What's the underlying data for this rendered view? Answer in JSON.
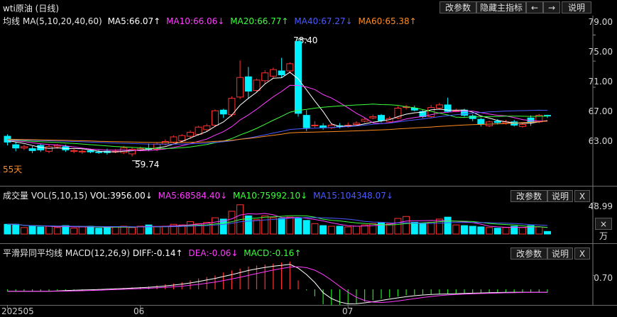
{
  "main": {
    "title": "wti原油 (日线)",
    "buttons": {
      "params": "改参数",
      "hide": "隐藏主指标",
      "prev": "←",
      "next": "→",
      "help": "说明"
    },
    "indicator": {
      "name": "均线",
      "params": "MA(5,10,20,40,60)",
      "ma5": "MA5:66.07↑",
      "ma10": "MA10:66.06↓",
      "ma20": "MA20:66.77↑",
      "ma40": "MA40:67.27↓",
      "ma60": "MA60:65.38↑"
    },
    "y_ticks": [
      "79.00",
      "75.00",
      "71.00",
      "67.00",
      "63.00"
    ],
    "high_label": "78.40",
    "low_label": "59.74",
    "days_label": "55天",
    "colors": {
      "ma5": "#ffffff",
      "ma10": "#ff3cff",
      "ma20": "#3cff3c",
      "ma40": "#4a5aff",
      "ma60": "#ff8c20",
      "up": "#ff3030",
      "down": "#00f0ff"
    }
  },
  "volume": {
    "name": "成交量",
    "params": "VOL(5,10,15)",
    "vol": "VOL:3956.00↓",
    "ma5": "MA5:68584.40↓",
    "ma10": "MA10:75992.10↓",
    "ma15": "MA15:104348.07↓",
    "buttons": {
      "params": "改参数",
      "help": "说明",
      "close": "X"
    },
    "y_tick": "48.99",
    "unit": "×万"
  },
  "macd": {
    "name": "平滑异同平均线",
    "params": "MACD(12,26,9)",
    "diff": "DIFF:-0.14↑",
    "dea": "DEA:-0.06↓",
    "macd": "MACD:-0.16↑",
    "buttons": {
      "params": "改参数",
      "help": "说明",
      "close": "X"
    },
    "y_tick": "0.70"
  },
  "x_axis": [
    "202505",
    "06",
    "07"
  ],
  "chart_data": {
    "type": "candlestick",
    "open": [
      63.5,
      62.2,
      61.7,
      61.6,
      62.1,
      61.2,
      61.9,
      61.9,
      61.3,
      61.2,
      61.3,
      61.1,
      61.2,
      61.1,
      61.0,
      60.8,
      61.4,
      61.6,
      61.5,
      62.3,
      62.6,
      62.8,
      63.5,
      63.8,
      64.5,
      65.2,
      67.5,
      66.8,
      69.5,
      72.6,
      70.5,
      72.0,
      72.7,
      73.5,
      73.5,
      78.0,
      66.7,
      65.1,
      65.1,
      64.8,
      65.1,
      65.0,
      65.3,
      65.8,
      66.3,
      66.7,
      65.7,
      66.3,
      67.9,
      67.8,
      67.3,
      66.5,
      67.8,
      68.3,
      67.3,
      67.5,
      66.6,
      66.1,
      65.1,
      65.8,
      65.5,
      65.7,
      65.0,
      66.3,
      65.7,
      66.7
    ],
    "close": [
      62.6,
      61.7,
      61.9,
      61.3,
      61.4,
      61.9,
      62.1,
      61.4,
      61.3,
      61.2,
      61.1,
      61.0,
      61.0,
      61.2,
      61.7,
      61.5,
      61.6,
      61.5,
      62.3,
      62.7,
      63.4,
      63.6,
      64.1,
      64.9,
      65.1,
      67.4,
      66.9,
      69.3,
      72.5,
      70.4,
      72.1,
      73.2,
      73.7,
      72.9,
      74.6,
      67.0,
      64.8,
      65.2,
      64.8,
      65.2,
      65.0,
      65.2,
      65.5,
      66.1,
      66.5,
      65.9,
      66.2,
      67.8,
      68.0,
      67.5,
      66.5,
      67.9,
      68.3,
      67.3,
      67.4,
      66.7,
      66.2,
      65.4,
      65.7,
      65.6,
      65.7,
      65.2,
      65.3,
      65.7,
      66.7,
      66.6
    ],
    "high": [
      63.8,
      62.6,
      62.2,
      62.0,
      62.3,
      62.2,
      62.3,
      62.2,
      61.6,
      61.5,
      61.6,
      61.4,
      61.6,
      61.5,
      62.0,
      61.8,
      61.9,
      62.4,
      62.5,
      63.0,
      63.6,
      63.8,
      64.4,
      65.1,
      65.4,
      67.6,
      67.7,
      69.6,
      75.1,
      74.1,
      72.3,
      73.6,
      74.0,
      75.5,
      74.8,
      78.4,
      67.5,
      65.8,
      65.5,
      65.4,
      65.5,
      65.6,
      65.8,
      66.4,
      66.8,
      66.9,
      66.5,
      68.1,
      68.3,
      68.2,
      67.5,
      68.3,
      68.6,
      69.4,
      67.7,
      67.7,
      66.9,
      66.3,
      65.9,
      66.1,
      66.0,
      66.0,
      65.5,
      66.7,
      66.9,
      66.8
    ],
    "low": [
      62.1,
      61.2,
      61.4,
      60.9,
      61.1,
      60.9,
      61.6,
      61.1,
      60.9,
      60.8,
      60.9,
      60.8,
      60.7,
      60.9,
      60.8,
      60.4,
      61.2,
      61.2,
      61.2,
      62.1,
      62.4,
      62.5,
      63.1,
      63.6,
      64.2,
      64.9,
      66.3,
      66.5,
      69.2,
      69.2,
      70.2,
      71.5,
      72.4,
      72.5,
      73.1,
      66.5,
      64.3,
      64.8,
      64.5,
      64.6,
      64.7,
      64.8,
      65.1,
      65.6,
      66.1,
      65.6,
      65.5,
      66.1,
      67.6,
      67.3,
      66.3,
      66.3,
      67.6,
      67.1,
      67.2,
      66.5,
      65.8,
      65.0,
      64.9,
      65.3,
      65.3,
      65.0,
      64.8,
      65.1,
      65.5,
      66.3
    ],
    "volume": [
      15,
      15,
      10,
      12,
      11,
      12,
      10,
      13,
      9,
      11,
      12,
      9,
      10,
      11,
      12,
      10,
      12,
      14,
      11,
      12,
      15,
      14,
      19,
      16,
      18,
      25,
      23,
      35,
      45,
      28,
      22,
      28,
      25,
      24,
      26,
      25,
      21,
      16,
      13,
      12,
      12,
      11,
      12,
      14,
      16,
      17,
      16,
      24,
      27,
      18,
      17,
      18,
      23,
      26,
      14,
      13,
      12,
      11,
      10,
      9,
      10,
      12,
      10,
      13,
      11,
      4
    ],
    "macd": [
      -0.1,
      -0.1,
      -0.1,
      -0.12,
      -0.1,
      -0.08,
      -0.05,
      -0.04,
      -0.03,
      -0.02,
      0.0,
      0.02,
      0.03,
      0.05,
      0.07,
      0.1,
      0.12,
      0.15,
      0.2,
      0.25,
      0.3,
      0.36,
      0.45,
      0.55,
      0.62,
      0.7,
      0.85,
      0.95,
      1.05,
      1.15,
      1.2,
      1.25,
      1.3,
      1.35,
      1.4,
      0.45,
      -0.05,
      -0.35,
      -0.75,
      -0.8,
      -0.78,
      -0.76,
      -0.7,
      -0.62,
      -0.55,
      -0.48,
      -0.42,
      -0.36,
      -0.3,
      -0.28,
      -0.26,
      -0.25,
      -0.24,
      -0.22,
      -0.21,
      -0.2,
      -0.18,
      -0.17,
      -0.16,
      -0.16,
      -0.15,
      -0.15,
      -0.15,
      -0.16,
      -0.16,
      -0.16
    ],
    "y_ticks": [
      79,
      75,
      71,
      67,
      63
    ],
    "ylim": [
      58.3,
      81.1
    ],
    "high_mark": 78.4,
    "low_mark": 59.74
  }
}
